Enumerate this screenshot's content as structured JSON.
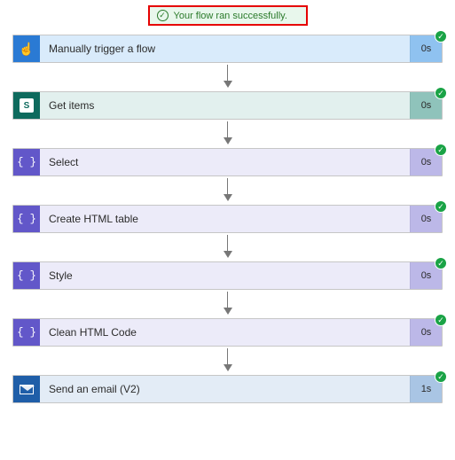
{
  "banner": {
    "text": "Your flow ran successfully."
  },
  "steps": [
    {
      "label": "Manually trigger a flow",
      "duration": "0s"
    },
    {
      "label": "Get items",
      "duration": "0s"
    },
    {
      "label": "Select",
      "duration": "0s"
    },
    {
      "label": "Create HTML table",
      "duration": "0s"
    },
    {
      "label": "Style",
      "duration": "0s"
    },
    {
      "label": "Clean HTML Code",
      "duration": "0s"
    },
    {
      "label": "Send an email (V2)",
      "duration": "1s"
    }
  ]
}
